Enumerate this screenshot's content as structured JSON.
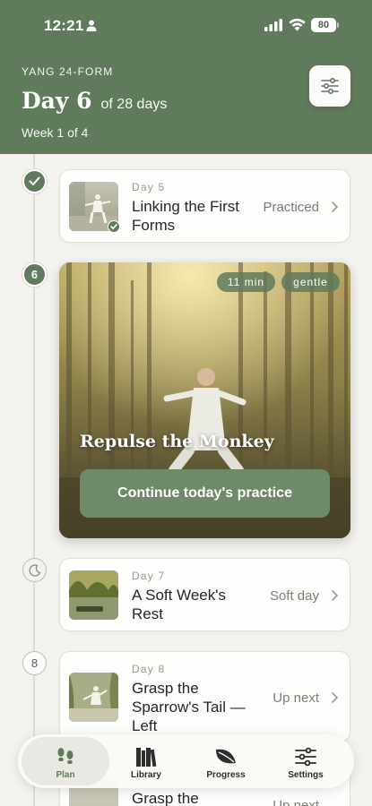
{
  "status_bar": {
    "time": "12:21",
    "battery": "80"
  },
  "header": {
    "eyebrow": "YANG 24-FORM",
    "day_label": "Day 6",
    "of_label": "of 28 days",
    "week_label": "Week 1 of 4"
  },
  "timeline": [
    {
      "node": "check-icon",
      "day": "Day 5",
      "title": "Linking the First Forms",
      "status": "Practiced"
    },
    {
      "node": "6",
      "hero": true,
      "duration": "11 min",
      "intensity": "gentle",
      "title": "Repulse the Monkey",
      "cta": "Continue today's practice"
    },
    {
      "node": "moon-icon",
      "day": "Day 7",
      "title": "A Soft Week's Rest",
      "status": "Soft day"
    },
    {
      "node": "8",
      "day": "Day 8",
      "title": "Grasp the Sparrow's Tail — Left",
      "status": "Up next"
    },
    {
      "day": "",
      "title": "Grasp the",
      "status": "Up next"
    }
  ],
  "tabbar": {
    "tabs": [
      {
        "label": "Plan",
        "icon": "footprints-icon",
        "active": true
      },
      {
        "label": "Library",
        "icon": "books-icon"
      },
      {
        "label": "Progress",
        "icon": "leaf-icon"
      },
      {
        "label": "Settings",
        "icon": "sliders-icon"
      }
    ]
  },
  "colors": {
    "primary": "#607a5c",
    "background": "#f3f2ee",
    "card": "#fdfdfb"
  }
}
